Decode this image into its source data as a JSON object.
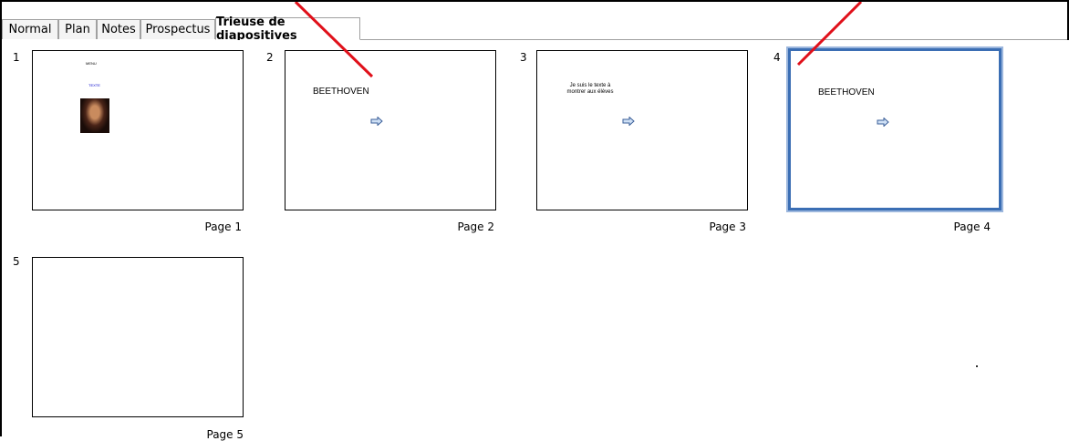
{
  "tabs": [
    {
      "label": "Normal",
      "active": false
    },
    {
      "label": "Plan",
      "active": false
    },
    {
      "label": "Notes",
      "active": false
    },
    {
      "label": "Prospectus",
      "active": false
    },
    {
      "label": "Trieuse de diapositives",
      "active": true
    }
  ],
  "slides": [
    {
      "number": "1",
      "page_label": "Page 1",
      "title": "",
      "menu_text": "MENU",
      "link_text": "TEXTE",
      "has_image": true,
      "has_arrow": false,
      "selected": false
    },
    {
      "number": "2",
      "page_label": "Page 2",
      "title": "BEETHOVEN",
      "has_arrow": true,
      "selected": false
    },
    {
      "number": "3",
      "page_label": "Page 3",
      "body_line1": "Je suis le texte à",
      "body_line2": "montrer aux élèves",
      "has_arrow": true,
      "selected": false
    },
    {
      "number": "4",
      "page_label": "Page 4",
      "title": "BEETHOVEN",
      "has_arrow": true,
      "selected": true
    },
    {
      "number": "5",
      "page_label": "Page 5",
      "has_arrow": false,
      "selected": false
    }
  ],
  "colors": {
    "selection_border": "#3b6eb4",
    "annotation_line": "#e0101a",
    "arrow_fill": "#cfe0f5",
    "arrow_stroke": "#3b5f99"
  }
}
